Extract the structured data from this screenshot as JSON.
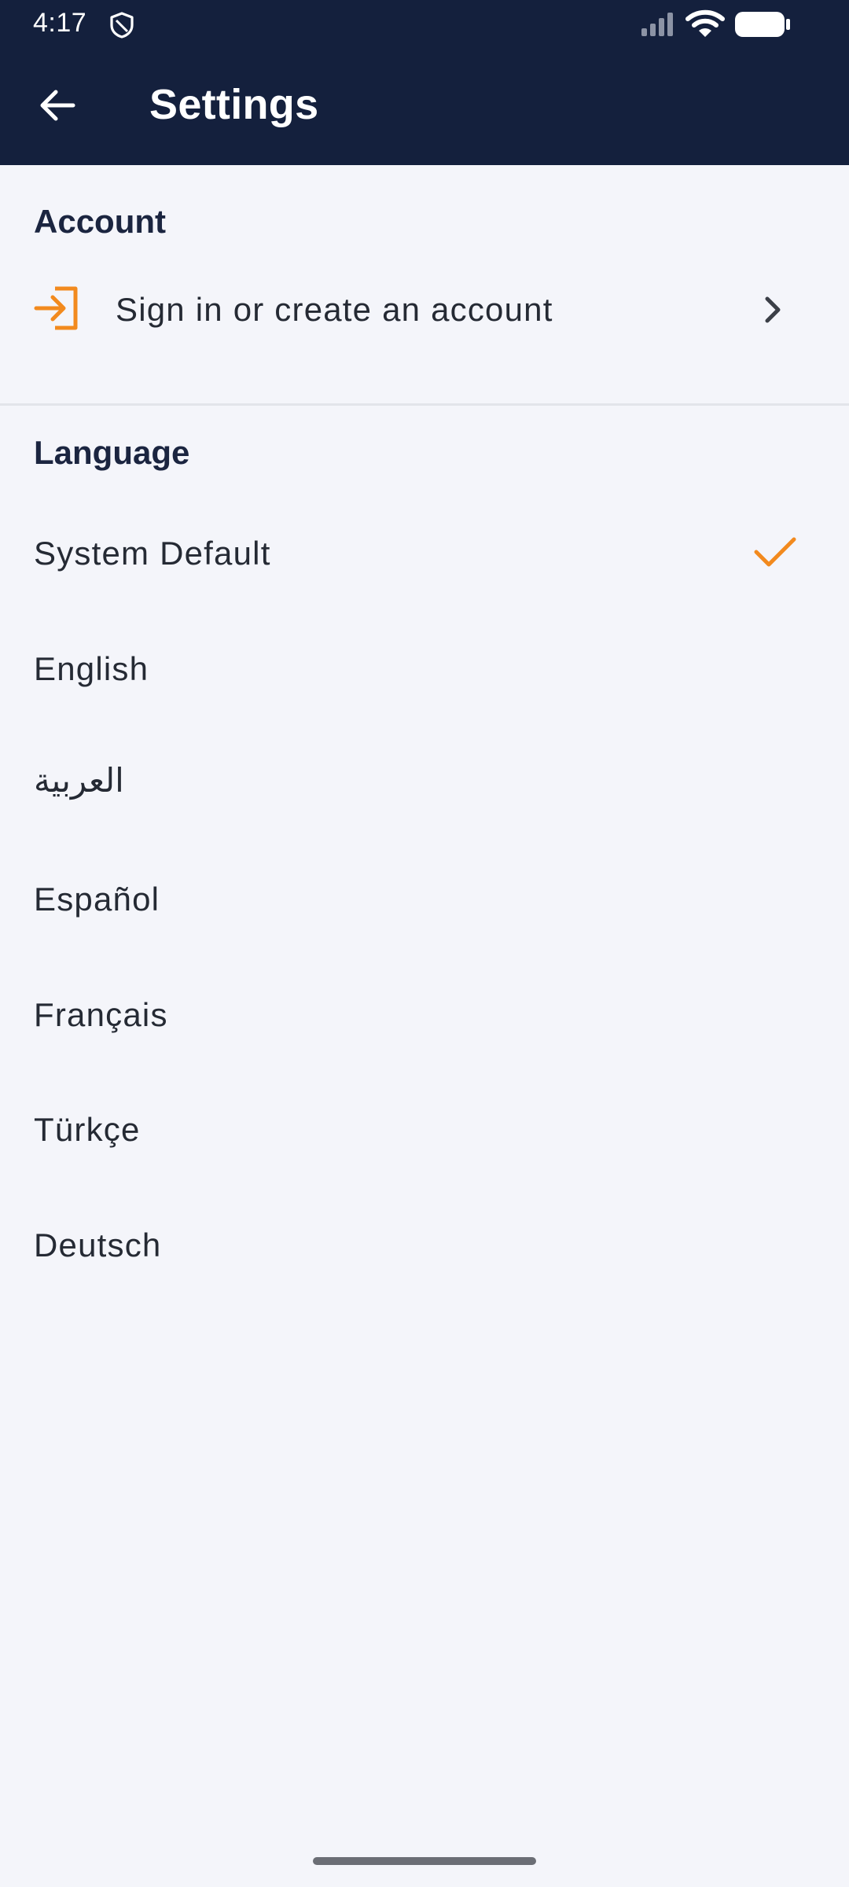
{
  "status_bar": {
    "time": "4:17",
    "icons": [
      "shield-icon",
      "signal-icon",
      "wifi-icon",
      "battery-icon"
    ]
  },
  "app_bar": {
    "title": "Settings",
    "back_icon": "back-arrow-icon"
  },
  "account_section": {
    "header": "Account",
    "item_label": "Sign in or create an account",
    "item_icon": "sign-in-icon",
    "item_chevron": "chevron-right-icon"
  },
  "language_section": {
    "header": "Language",
    "items": [
      {
        "label": "System Default",
        "selected": true
      },
      {
        "label": "English",
        "selected": false
      },
      {
        "label": "العربية",
        "selected": false
      },
      {
        "label": "Español",
        "selected": false
      },
      {
        "label": "Français",
        "selected": false
      },
      {
        "label": "Türkçe",
        "selected": false
      },
      {
        "label": "Deutsch",
        "selected": false
      }
    ]
  },
  "colors": {
    "header_bg": "#14203d",
    "accent": "#f28a1e",
    "page_bg": "#f4f5fa",
    "section_header_text": "#1b2540",
    "body_text": "#252a34"
  }
}
